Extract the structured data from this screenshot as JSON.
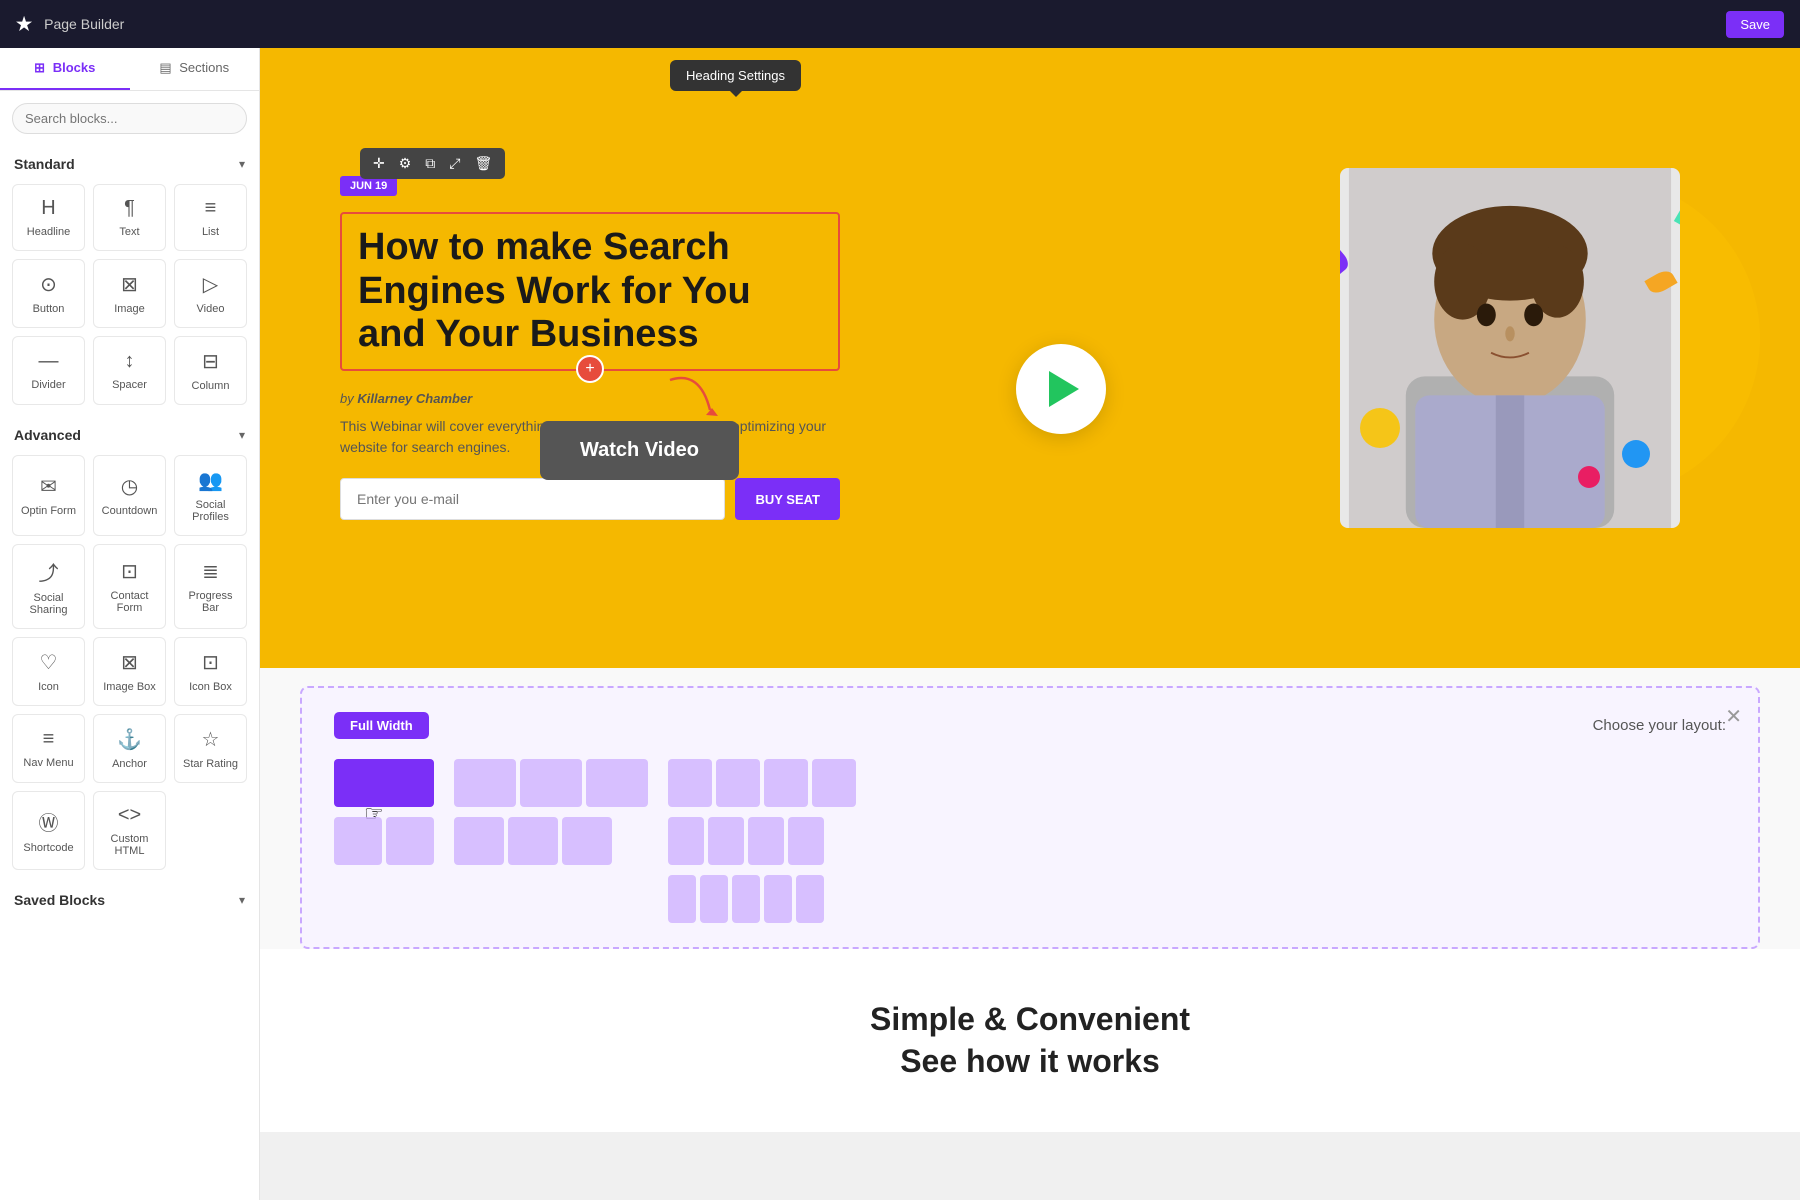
{
  "topbar": {
    "logo": "★",
    "title": "Page Builder",
    "save_label": "Save"
  },
  "sidebar": {
    "tabs": [
      {
        "id": "blocks",
        "label": "Blocks",
        "icon": "⊞",
        "active": true
      },
      {
        "id": "sections",
        "label": "Sections",
        "icon": "▤",
        "active": false
      }
    ],
    "search_placeholder": "Search blocks...",
    "sections": [
      {
        "id": "standard",
        "label": "Standard",
        "expanded": true,
        "blocks": [
          {
            "id": "headline",
            "icon": "H",
            "label": "Headline"
          },
          {
            "id": "text",
            "icon": "¶",
            "label": "Text"
          },
          {
            "id": "list",
            "icon": "≡",
            "label": "List"
          },
          {
            "id": "button",
            "icon": "⊙",
            "label": "Button"
          },
          {
            "id": "image",
            "icon": "⊠",
            "label": "Image"
          },
          {
            "id": "video",
            "icon": "▷",
            "label": "Video"
          },
          {
            "id": "divider",
            "icon": "—",
            "label": "Divider"
          },
          {
            "id": "spacer",
            "icon": "↕",
            "label": "Spacer"
          },
          {
            "id": "column",
            "icon": "⊟",
            "label": "Column"
          }
        ]
      },
      {
        "id": "advanced",
        "label": "Advanced",
        "expanded": true,
        "blocks": [
          {
            "id": "optin-form",
            "icon": "✉",
            "label": "Optin Form"
          },
          {
            "id": "countdown",
            "icon": "◷",
            "label": "Countdown"
          },
          {
            "id": "social-profiles",
            "icon": "👥",
            "label": "Social Profiles"
          },
          {
            "id": "social-sharing",
            "icon": "⤴",
            "label": "Social Sharing"
          },
          {
            "id": "contact-form",
            "icon": "⊡",
            "label": "Contact Form"
          },
          {
            "id": "progress-bar",
            "icon": "≣",
            "label": "Progress Bar"
          },
          {
            "id": "icon",
            "icon": "♡",
            "label": "Icon"
          },
          {
            "id": "image-box",
            "icon": "⊠",
            "label": "Image Box"
          },
          {
            "id": "icon-box",
            "icon": "⊡",
            "label": "Icon Box"
          },
          {
            "id": "nav-menu",
            "icon": "≡",
            "label": "Nav Menu"
          },
          {
            "id": "anchor",
            "icon": "⚓",
            "label": "Anchor"
          },
          {
            "id": "star-rating",
            "icon": "☆",
            "label": "Star Rating"
          },
          {
            "id": "shortcode",
            "icon": "Ⓦ",
            "label": "Shortcode"
          },
          {
            "id": "custom-html",
            "icon": "<>",
            "label": "Custom HTML"
          }
        ]
      },
      {
        "id": "saved-blocks",
        "label": "Saved Blocks",
        "expanded": false,
        "blocks": []
      }
    ]
  },
  "canvas": {
    "heading_settings_tooltip": "Heading Settings",
    "date_badge": "JUN 19",
    "hero_heading": "How to make Search Engines Work for You and Your Business",
    "author_prefix": "by",
    "author_name": "Killarney Chamber",
    "description": "This Webinar will cover everything you need to get started with optimizing your website for search engines.",
    "email_placeholder": "Enter you e-mail",
    "cta_button": "BUY SEAT",
    "watch_video_label": "Watch Video",
    "layout_chooser": {
      "full_width_label": "Full Width",
      "choose_layout_label": "Choose your layout:"
    },
    "bottom": {
      "heading_line1": "Simple & Convenient",
      "heading_line2": "See how it works"
    }
  }
}
